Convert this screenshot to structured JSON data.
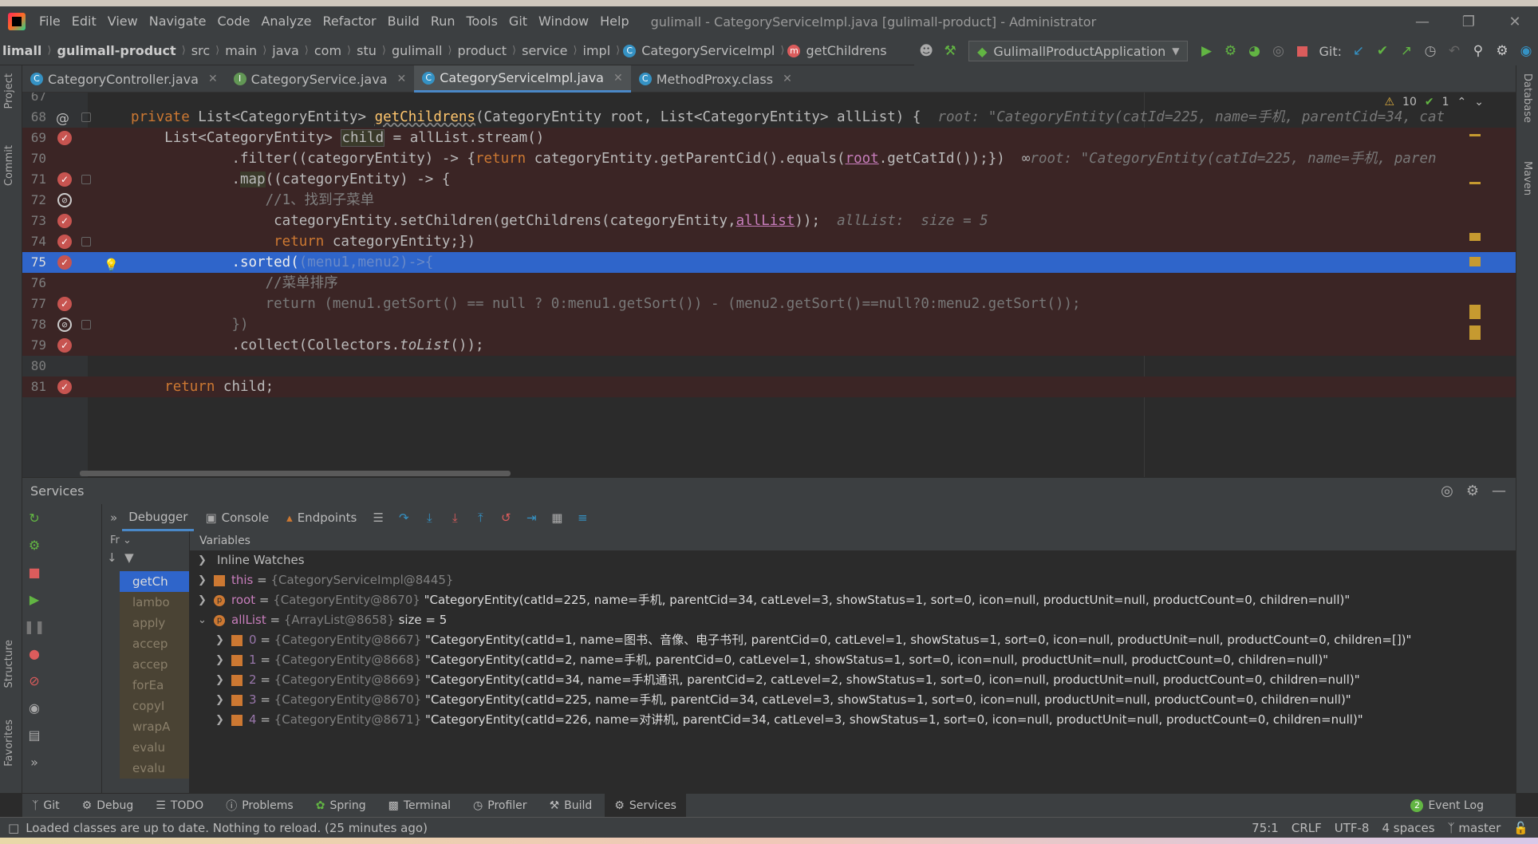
{
  "window": {
    "title": "gulimall - CategoryServiceImpl.java [gulimall-product] - Administrator",
    "menu": [
      "File",
      "Edit",
      "View",
      "Navigate",
      "Code",
      "Analyze",
      "Refactor",
      "Build",
      "Run",
      "Tools",
      "Git",
      "Window",
      "Help"
    ]
  },
  "breadcrumb": {
    "items": [
      "limall",
      "gulimall-product",
      "src",
      "main",
      "java",
      "com",
      "stu",
      "gulimall",
      "product",
      "service",
      "impl",
      "CategoryServiceImpl",
      "getChildrens"
    ]
  },
  "toolbar": {
    "run_config": "GulimallProductApplication",
    "git_label": "Git:"
  },
  "tabs": [
    {
      "label": "CategoryController.java",
      "icon": "class-icon"
    },
    {
      "label": "CategoryService.java",
      "icon": "interface-icon"
    },
    {
      "label": "CategoryServiceImpl.java",
      "icon": "class-icon",
      "active": true
    },
    {
      "label": "MethodProxy.class",
      "icon": "class-icon"
    }
  ],
  "editor": {
    "warnings": "10",
    "checks": "1",
    "lines": [
      {
        "n": "67"
      },
      {
        "n": "68"
      },
      {
        "n": "69"
      },
      {
        "n": "70"
      },
      {
        "n": "71"
      },
      {
        "n": "72"
      },
      {
        "n": "73"
      },
      {
        "n": "74"
      },
      {
        "n": "75"
      },
      {
        "n": "76"
      },
      {
        "n": "77"
      },
      {
        "n": "78"
      },
      {
        "n": "79"
      },
      {
        "n": "80"
      },
      {
        "n": "81"
      }
    ],
    "code": {
      "l68_kw": "private ",
      "l68_type": "List<CategoryEntity> ",
      "l68_fn": "getChildrens",
      "l68_params": "(CategoryEntity root, List<CategoryEntity> allList) {",
      "l68_hint": "root: \"CategoryEntity(catId=225, name=手机, parentCid=34, cat",
      "l69_a": "List<CategoryEntity> ",
      "l69_child": "child",
      "l69_b": " = allList.stream()",
      "l70_a": ".filter((categoryEntity) -> {",
      "l70_kw": "return ",
      "l70_b": "categoryEntity.getParentCid().equals(",
      "l70_root": "root",
      "l70_c": ".getCatId());})",
      "l70_hint": "root: \"CategoryEntity(catId=225, name=手机, paren",
      "l71_a": ".",
      "l71_map": "map",
      "l71_b": "((categoryEntity) -> {",
      "l72_cm": "//1、找到子菜单",
      "l73_a": "categoryEntity.setChildren(getChildrens(categoryEntity,",
      "l73_all": "allList",
      "l73_b": "));",
      "l73_hint": "allList:  size = 5",
      "l74_kw": "return ",
      "l74_b": "categoryEntity;})",
      "l75_a": ".sorted(",
      "l75_gr": "(menu1,menu2)->{",
      "l76_cm": "//菜单排序",
      "l77": "return (menu1.getSort() == null ? 0:menu1.getSort()) - (menu2.getSort()==null?0:menu2.getSort());",
      "l78": "})",
      "l79_a": ".collect(Collectors.",
      "l79_it": "toList",
      "l79_b": "());",
      "l81_kw": "return ",
      "l81_b": "child;"
    }
  },
  "services": {
    "title": "Services",
    "tabs": [
      "Debugger",
      "Console",
      "Endpoints"
    ],
    "frames_label": "Fr",
    "frames": [
      "getCh",
      "lambo",
      "apply",
      "accep",
      "accep",
      "forEa",
      "copyI",
      "wrapA",
      "evalu",
      "evalu"
    ],
    "variables_label": "Variables",
    "inline_watches": "Inline Watches",
    "vars": [
      {
        "name": "this",
        "ref": "{CategoryServiceImpl@8445}",
        "val": ""
      },
      {
        "name": "root",
        "ref": "{CategoryEntity@8670}",
        "val": "\"CategoryEntity(catId=225, name=手机, parentCid=34, catLevel=3, showStatus=1, sort=0, icon=null, productUnit=null, productCount=0, children=null)\""
      },
      {
        "name": "allList",
        "ref": "{ArrayList@8658}",
        "val": "size = 5"
      }
    ],
    "items": [
      {
        "idx": "0",
        "ref": "{CategoryEntity@8667}",
        "val": "\"CategoryEntity(catId=1, name=图书、音像、电子书刊, parentCid=0, catLevel=1, showStatus=1, sort=0, icon=null, productUnit=null, productCount=0, children=[])\""
      },
      {
        "idx": "1",
        "ref": "{CategoryEntity@8668}",
        "val": "\"CategoryEntity(catId=2, name=手机, parentCid=0, catLevel=1, showStatus=1, sort=0, icon=null, productUnit=null, productCount=0, children=null)\""
      },
      {
        "idx": "2",
        "ref": "{CategoryEntity@8669}",
        "val": "\"CategoryEntity(catId=34, name=手机通讯, parentCid=2, catLevel=2, showStatus=1, sort=0, icon=null, productUnit=null, productCount=0, children=null)\""
      },
      {
        "idx": "3",
        "ref": "{CategoryEntity@8670}",
        "val": "\"CategoryEntity(catId=225, name=手机, parentCid=34, catLevel=3, showStatus=1, sort=0, icon=null, productUnit=null, productCount=0, children=null)\""
      },
      {
        "idx": "4",
        "ref": "{CategoryEntity@8671}",
        "val": "\"CategoryEntity(catId=226, name=对讲机, parentCid=34, catLevel=3, showStatus=1, sort=0, icon=null, productUnit=null, productCount=0, children=null)\""
      }
    ]
  },
  "bottom_tabs": [
    "Git",
    "Debug",
    "TODO",
    "Problems",
    "Spring",
    "Terminal",
    "Profiler",
    "Build",
    "Services"
  ],
  "event_log": {
    "count": "2",
    "label": "Event Log"
  },
  "side": {
    "left": [
      "Project",
      "Commit",
      "Structure",
      "Favorites"
    ],
    "right": [
      "Database",
      "Maven"
    ]
  },
  "status": {
    "message": "Loaded classes are up to date. Nothing to reload. (25 minutes ago)",
    "position": "75:1",
    "line_sep": "CRLF",
    "encoding": "UTF-8",
    "indent": "4 spaces",
    "branch": "master"
  },
  "colors": {
    "accent": "#2f65ca",
    "breakpoint": "#c75450",
    "keyword": "#cc7832",
    "function": "#ffc66d"
  }
}
